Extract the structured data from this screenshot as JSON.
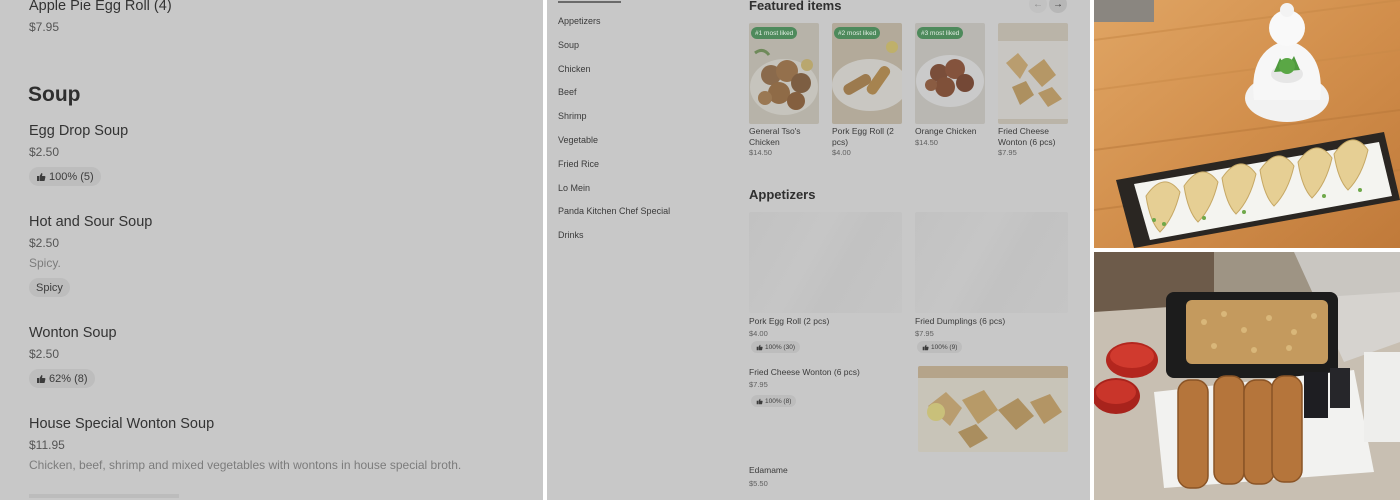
{
  "menu_left": {
    "top_item": {
      "name": "Apple Pie Egg Roll (4)",
      "price": "$7.95"
    },
    "section_title": "Soup",
    "items": [
      {
        "name": "Egg Drop Soup",
        "price": "$2.50",
        "rating": "100% (5)"
      },
      {
        "name": "Hot and Sour Soup",
        "price": "$2.50",
        "description": "Spicy.",
        "tag": "Spicy"
      },
      {
        "name": "Wonton Soup",
        "price": "$2.50",
        "rating": "62% (8)"
      },
      {
        "name": "House Special Wonton Soup",
        "price": "$11.95",
        "description": "Chicken, beef, shrimp and mixed vegetables with wontons in house special broth."
      }
    ]
  },
  "category_nav": {
    "items": [
      "Appetizers",
      "Soup",
      "Chicken",
      "Beef",
      "Shrimp",
      "Vegetable",
      "Fried Rice",
      "Lo Mein",
      "Panda Kitchen Chef Special",
      "Drinks"
    ]
  },
  "featured": {
    "title": "Featured items",
    "prev_icon": "arrow-left-icon",
    "next_icon": "arrow-right-icon",
    "items": [
      {
        "badge": "#1 most liked",
        "name": "General Tso's Chicken",
        "price": "$14.50"
      },
      {
        "badge": "#2 most liked",
        "name": "Pork Egg Roll (2 pcs)",
        "price": "$4.00"
      },
      {
        "badge": "#3 most liked",
        "name": "Orange Chicken",
        "price": "$14.50"
      },
      {
        "badge": "",
        "name": "Fried Cheese Wonton (6 pcs)",
        "price": "$7.95"
      }
    ]
  },
  "appetizers": {
    "title": "Appetizers",
    "items": [
      {
        "name": "Pork Egg Roll (2 pcs)",
        "price": "$4.00",
        "rating": "100% (30)"
      },
      {
        "name": "Fried Dumplings (6 pcs)",
        "price": "$7.95",
        "rating": "100% (9)"
      },
      {
        "name": "Fried Cheese Wonton (6 pcs)",
        "price": "$7.95",
        "rating": "100% (8)"
      },
      {
        "name": "Edamame",
        "price": "$5.50"
      }
    ]
  },
  "colors": {
    "overlay_gray": "#c8c8c8",
    "badge_green": "#4e8a5c",
    "pill_gray": "#bdbdbd"
  }
}
